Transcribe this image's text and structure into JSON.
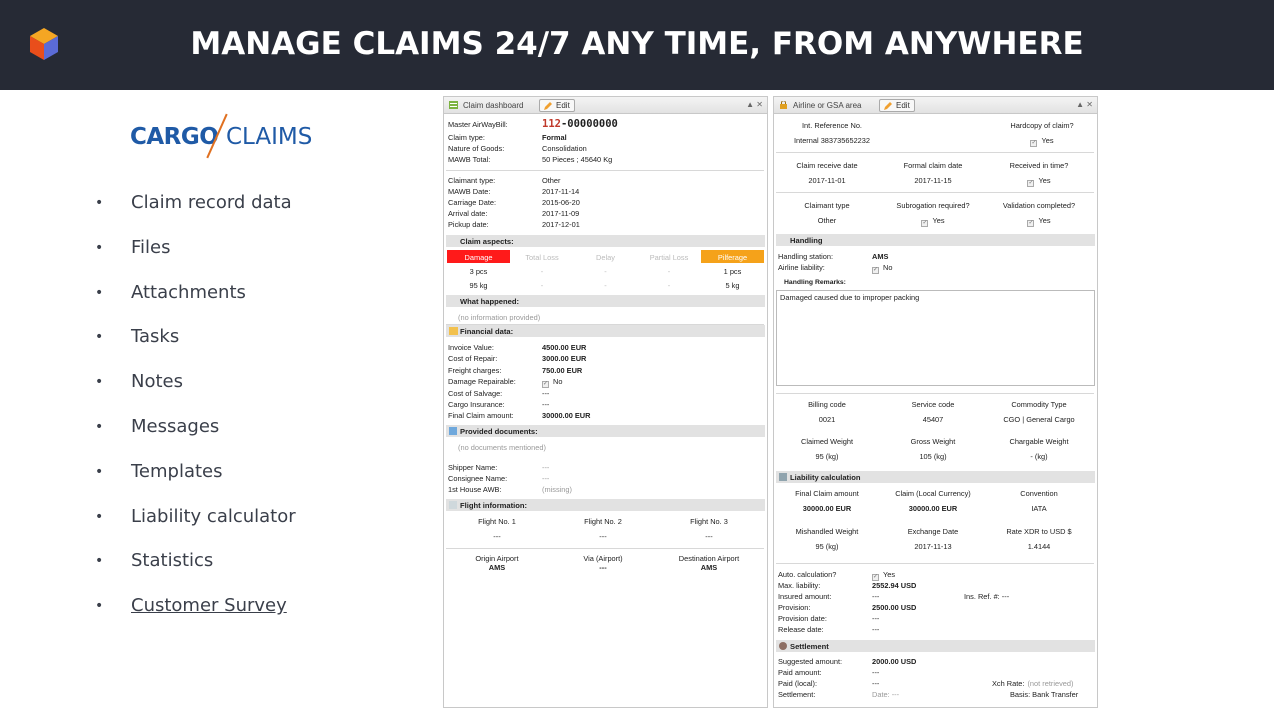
{
  "header": {
    "title": "MANAGE CLAIMS 24/7 ANY TIME, FROM ANYWHERE"
  },
  "brand": {
    "part1": "CARGO",
    "part2": "CLAIMS"
  },
  "features": [
    {
      "label": "Claim record data",
      "link": false
    },
    {
      "label": "Files",
      "link": false
    },
    {
      "label": "Attachments",
      "link": false
    },
    {
      "label": "Tasks",
      "link": false
    },
    {
      "label": "Notes",
      "link": false
    },
    {
      "label": "Messages",
      "link": false
    },
    {
      "label": "Templates",
      "link": false
    },
    {
      "label": "Liability calculator",
      "link": false
    },
    {
      "label": "Statistics",
      "link": false
    },
    {
      "label": "Customer Survey",
      "link": true
    }
  ],
  "bullet": "•",
  "left_panel": {
    "title": "Claim dashboard",
    "edit": "Edit",
    "controls": "▲ ✕",
    "awb_label": "Master AirWayBill:",
    "awb_prefix": "112",
    "awb_number": "-00000000",
    "info": [
      {
        "k": "Claim type:",
        "v": "Formal",
        "bold": true
      },
      {
        "k": "Nature of Goods:",
        "v": "Consolidation",
        "bold": false
      },
      {
        "k": "MAWB Total:",
        "v": "50 Pieces ; 45640 Kg",
        "bold": false
      }
    ],
    "dates": [
      {
        "k": "Claimant type:",
        "v": "Other"
      },
      {
        "k": "MAWB Date:",
        "v": "2017-11-14"
      },
      {
        "k": "Carriage Date:",
        "v": "2015-06-20"
      },
      {
        "k": "Arrival date:",
        "v": "2017-11-09"
      },
      {
        "k": "Pickup date:",
        "v": "2017-12-01"
      }
    ],
    "aspects_title": "Claim aspects:",
    "aspects": [
      {
        "name": "Damage",
        "pcs": "3 pcs",
        "kg": "95 kg",
        "bg": "#ff1a1a",
        "fg": "#ffffff"
      },
      {
        "name": "Total Loss",
        "pcs": "-",
        "kg": "-",
        "bg": "#ffffff",
        "fg": "#bbbbbb"
      },
      {
        "name": "Delay",
        "pcs": "-",
        "kg": "-",
        "bg": "#ffffff",
        "fg": "#bbbbbb"
      },
      {
        "name": "Partial Loss",
        "pcs": "-",
        "kg": "-",
        "bg": "#ffffff",
        "fg": "#bbbbbb"
      },
      {
        "name": "Pilferage",
        "pcs": "1 pcs",
        "kg": "5 kg",
        "bg": "#f5a21a",
        "fg": "#ffffff"
      }
    ],
    "what_title": "What happened:",
    "what_text": "(no information provided)",
    "fin_title": "Financial data:",
    "fin": [
      {
        "k": "Invoice Value:",
        "v": "4500.00 EUR",
        "bold": true
      },
      {
        "k": "Cost of Repair:",
        "v": "3000.00 EUR",
        "bold": true
      },
      {
        "k": "Freight charges:",
        "v": "750.00 EUR",
        "bold": true
      },
      {
        "k": "Damage Repairable:",
        "v": "No",
        "chk": true
      },
      {
        "k": "Cost of Salvage:",
        "v": "---",
        "bold": false
      },
      {
        "k": "Cargo Insurance:",
        "v": "---",
        "bold": false
      },
      {
        "k": "Final Claim amount:",
        "v": "30000.00 EUR",
        "bold": true
      }
    ],
    "docs_title": "Provided documents:",
    "docs_text": "(no documents mentioned)",
    "parties": [
      {
        "k": "Shipper Name:",
        "v": "---"
      },
      {
        "k": "Consignee Name:",
        "v": "---"
      },
      {
        "k": "1st House AWB:",
        "v": "(missing)"
      }
    ],
    "flight_title": "Flight information:",
    "flights": [
      {
        "h": "Flight No. 1",
        "v": "---"
      },
      {
        "h": "Flight No. 2",
        "v": "---"
      },
      {
        "h": "Flight No. 3",
        "v": "---"
      }
    ],
    "airports": [
      {
        "h": "Origin Airport",
        "v": "AMS"
      },
      {
        "h": "Via (Airport)",
        "v": "---"
      },
      {
        "h": "Destination Airport",
        "v": "AMS"
      }
    ]
  },
  "right_panel": {
    "title": "Airline or GSA area",
    "edit": "Edit",
    "controls": "▲ ✕",
    "grid1": [
      {
        "h": "Int. Reference No.",
        "v": "Internal 383735652232"
      },
      {
        "h": "Hardcopy of claim?",
        "v": "Yes",
        "chk": true
      }
    ],
    "grid2": [
      {
        "h": "Claim receive date",
        "v": "2017-11-01"
      },
      {
        "h": "Formal claim date",
        "v": "2017-11-15"
      },
      {
        "h": "Received in time?",
        "v": "Yes",
        "chk": true
      }
    ],
    "grid3": [
      {
        "h": "Claimant type",
        "v": "Other"
      },
      {
        "h": "Subrogation required?",
        "v": "Yes",
        "chk": true
      },
      {
        "h": "Validation completed?",
        "v": "Yes",
        "chk": true
      }
    ],
    "handling_title": "Handling",
    "handling_station_k": "Handling station:",
    "handling_station_v": "AMS",
    "airline_liab_k": "Airline liability:",
    "airline_liab_v": "No",
    "remarks_title": "Handling Remarks:",
    "remarks": "Damaged caused due to improper packing",
    "grid4": [
      {
        "h": "Billing code",
        "v": "0021"
      },
      {
        "h": "Service code",
        "v": "45407"
      },
      {
        "h": "Commodity Type",
        "v": "CGO | General Cargo"
      }
    ],
    "grid5": [
      {
        "h": "Claimed Weight",
        "v": "95 (kg)"
      },
      {
        "h": "Gross Weight",
        "v": "105 (kg)"
      },
      {
        "h": "Chargable Weight",
        "v": "- (kg)"
      }
    ],
    "liab_title": "Liability calculation",
    "grid6": [
      {
        "h": "Final Claim amount",
        "v": "30000.00 EUR",
        "bold": true
      },
      {
        "h": "Claim (Local Currency)",
        "v": "30000.00 EUR",
        "bold": true
      },
      {
        "h": "Convention",
        "v": "IATA"
      }
    ],
    "grid7": [
      {
        "h": "Mishandled Weight",
        "v": "95 (kg)"
      },
      {
        "h": "Exchange Date",
        "v": "2017-11-13"
      },
      {
        "h": "Rate XDR to USD $",
        "v": "1.4144"
      }
    ],
    "calc": [
      {
        "k": "Auto. calculation?",
        "v": "Yes",
        "chk": true
      },
      {
        "k": "Max. liability:",
        "v": "2552.94 USD",
        "bold": true
      },
      {
        "k": "Insured amount:",
        "v": "---"
      },
      {
        "k": "Provision:",
        "v": "2500.00 USD",
        "bold": true
      },
      {
        "k": "Provision date:",
        "v": "---"
      },
      {
        "k": "Release date:",
        "v": "---"
      }
    ],
    "ins_ref": "Ins. Ref. #: ---",
    "settle_title": "Settlement",
    "settle": [
      {
        "k": "Suggested amount:",
        "v": "2000.00 USD",
        "bold": true
      },
      {
        "k": "Paid amount:",
        "v": "---"
      },
      {
        "k": "Paid (local):",
        "v": "---"
      },
      {
        "k": "Settlement:",
        "v": "Date: ---"
      }
    ],
    "xch_label": "Xch Rate:",
    "xch_value": "(not retrieved)",
    "basis": "Basis: Bank Transfer"
  }
}
